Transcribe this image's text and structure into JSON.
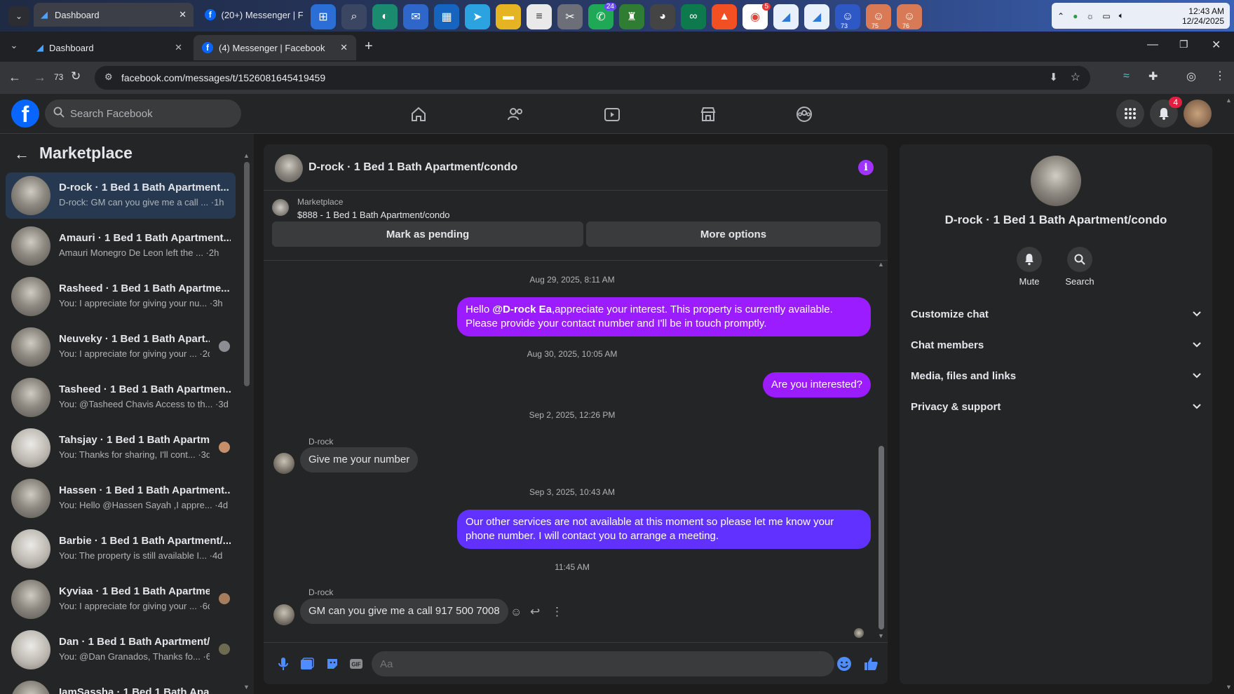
{
  "os": {
    "tabs": [
      {
        "label": "Dashboard"
      },
      {
        "label": "(20+) Messenger | Face"
      }
    ],
    "clock": {
      "time": "12:43 AM",
      "date": "12/24/2025"
    },
    "taskbar_badges": {
      "whatsapp": "24",
      "chrome": "5",
      "app1": "73",
      "app2": "75",
      "app3": "76"
    }
  },
  "browser": {
    "tabs": [
      {
        "label": "Dashboard"
      },
      {
        "label": "(4) Messenger | Facebook"
      }
    ],
    "back_count": "73",
    "url": "facebook.com/messages/t/1526081645419459"
  },
  "facebook": {
    "search_placeholder": "Search Facebook",
    "notifications_count": "4"
  },
  "sidebar": {
    "title": "Marketplace",
    "conversations": [
      {
        "name": "D-rock · 1 Bed 1 Bath Apartment...",
        "snippet": "D-rock: GM can you give me a call ... ·1h"
      },
      {
        "name": "Amauri · 1 Bed 1 Bath Apartment...",
        "snippet": "Amauri Monegro De Leon left the ... ·2h"
      },
      {
        "name": "Rasheed · 1 Bed 1 Bath Apartme...",
        "snippet": "You: I appreciate for giving your nu... ·3h"
      },
      {
        "name": "Neuveky · 1 Bed 1 Bath Apart...",
        "snippet": "You: I appreciate for giving your ... ·2d"
      },
      {
        "name": "Tasheed · 1 Bed 1 Bath Apartmen...",
        "snippet": "You: @Tasheed Chavis Access to th... ·3d"
      },
      {
        "name": "Tahsjay · 1 Bed 1 Bath Apartm...",
        "snippet": "You: Thanks for sharing, I'll cont... ·3d"
      },
      {
        "name": "Hassen · 1 Bed 1 Bath Apartment...",
        "snippet": "You: Hello @Hassen Sayah ,I appre... ·4d"
      },
      {
        "name": "Barbie · 1 Bed 1 Bath Apartment/...",
        "snippet": "You: The property is still available I... ·4d"
      },
      {
        "name": "Kyviaa · 1 Bed 1 Bath Apartme...",
        "snippet": "You: I appreciate for giving your ... ·6d"
      },
      {
        "name": "Dan · 1 Bed 1 Bath Apartment/...",
        "snippet": "You: @Dan Granados, Thanks fo... ·6d"
      },
      {
        "name": "IamSassha · 1 Bed 1 Bath Apar...",
        "snippet": ""
      }
    ]
  },
  "chat": {
    "title": "D-rock · 1 Bed 1 Bath Apartment/condo",
    "listing": {
      "source": "Marketplace",
      "title": "$888 - 1 Bed 1 Bath Apartment/condo"
    },
    "mark_pending_label": "Mark as pending",
    "more_options_label": "More options",
    "timestamps": [
      "Aug 29, 2025, 8:11 AM",
      "Aug 30, 2025, 10:05 AM",
      "Sep 2, 2025, 12:26 PM",
      "Sep 3, 2025, 10:43 AM",
      "11:45 AM"
    ],
    "messages": {
      "m1_pre": "Hello ",
      "m1_mention": "@D-rock Ea",
      "m1_post": ",appreciate your interest. This property is currently available. Please provide your contact number and I'll be in touch promptly.",
      "m2": "Are you interested?",
      "m3_sender": "D-rock",
      "m3": "Give me your number",
      "m4": "Our other services are not available at this moment so please let me know your phone number. I will contact you to arrange a meeting.",
      "m5_sender": "D-rock",
      "m5": "GM can you give me a call 917 500 7008"
    },
    "composer_placeholder": "Aa"
  },
  "info_panel": {
    "name": "D-rock · 1 Bed 1 Bath Apartment/condo",
    "mute_label": "Mute",
    "search_label": "Search",
    "sections": [
      "Customize chat",
      "Chat members",
      "Media, files and links",
      "Privacy & support"
    ]
  },
  "colors": {
    "accent": "#9b1cff",
    "fb_blue": "#0866ff",
    "bg": "#242526"
  }
}
